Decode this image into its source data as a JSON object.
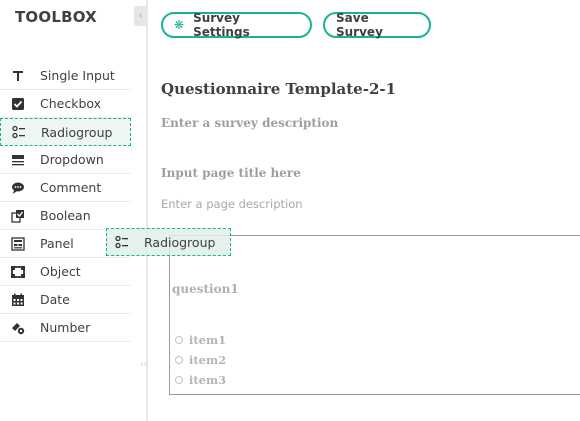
{
  "toolbox": {
    "title": "TOOLBOX",
    "items": [
      {
        "label": "Single Input",
        "icon": "text-input-icon"
      },
      {
        "label": "Checkbox",
        "icon": "checkbox-icon"
      },
      {
        "label": "Radiogroup",
        "icon": "radiogroup-icon",
        "active": true
      },
      {
        "label": "Dropdown",
        "icon": "dropdown-icon"
      },
      {
        "label": "Comment",
        "icon": "comment-icon"
      },
      {
        "label": "Boolean",
        "icon": "boolean-icon"
      },
      {
        "label": "Panel",
        "icon": "panel-icon"
      },
      {
        "label": "Object",
        "icon": "object-icon"
      },
      {
        "label": "Date",
        "icon": "calendar-icon"
      },
      {
        "label": "Number",
        "icon": "number-icon"
      }
    ]
  },
  "toolbar": {
    "settings_label": "Survey Settings",
    "save_label": "Save Survey"
  },
  "survey": {
    "title": "Questionnaire Template-2-1",
    "description_placeholder": "Enter a survey description",
    "page_title_placeholder": "Input page title here",
    "page_description_placeholder": "Enter a page description",
    "question": {
      "title": "question1",
      "choices": [
        "item1",
        "item2",
        "item3"
      ]
    }
  },
  "drag_ghost": {
    "label": "Radiogroup",
    "icon": "radiogroup-icon"
  },
  "colors": {
    "accent": "#19b394",
    "text": "#404040",
    "muted": "#9e9e9e"
  }
}
